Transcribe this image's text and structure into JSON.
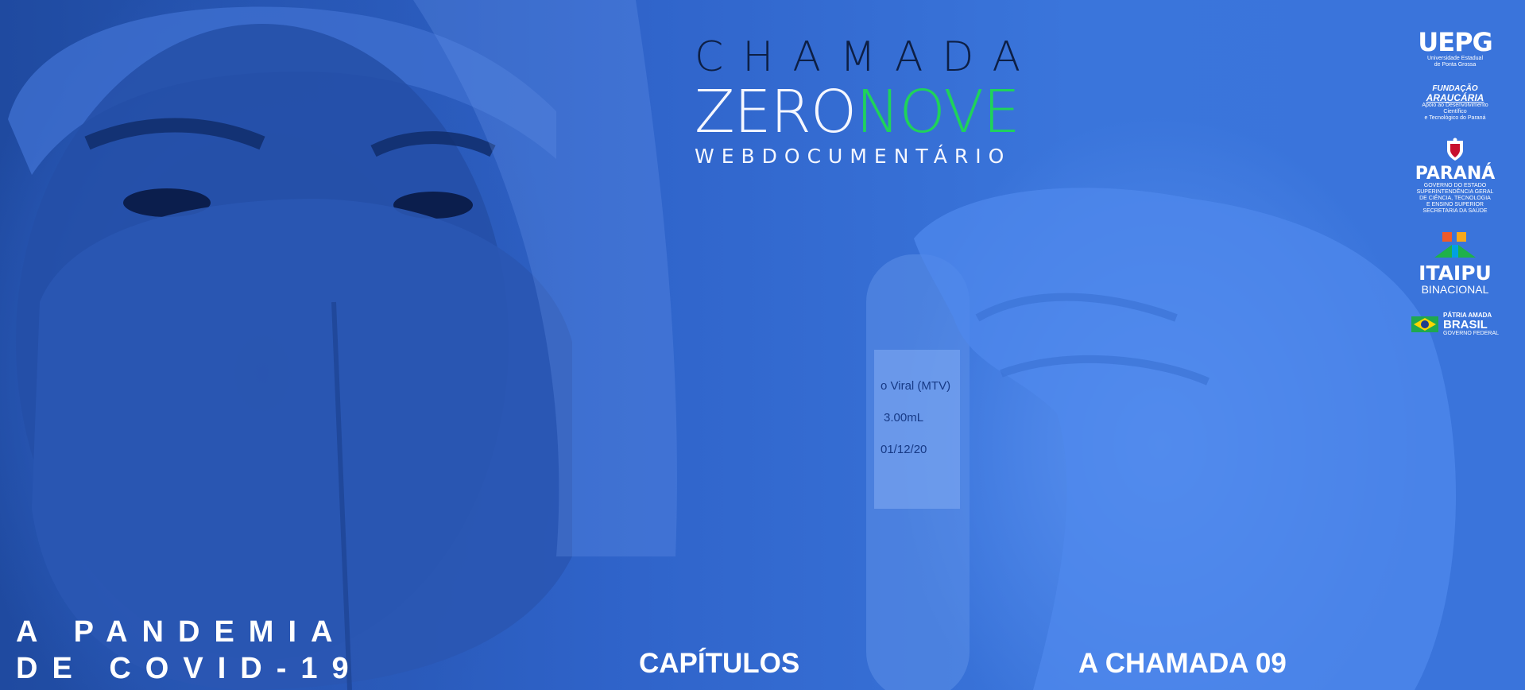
{
  "brand": {
    "title_top": "CHAMADA",
    "title_zero": "ZERO",
    "title_nove": "NOVE",
    "subtitle": "WEBDOCUMENTÁRIO",
    "colors": {
      "zero": "#f5f7ff",
      "nove": "#1fd35a",
      "top": "#0d1f45"
    }
  },
  "sponsors": {
    "uepg": {
      "mark": "UEPG",
      "line1": "Universidade Estadual",
      "line2": "de Ponta Grossa"
    },
    "araucaria": {
      "line1": "FUNDAÇÃO",
      "line2": "ARAUCÁRIA",
      "line3": "Apoio ao Desenvolvimento Científico",
      "line4": "e Tecnológico do Paraná"
    },
    "parana": {
      "name": "PARANÁ",
      "gov": "GOVERNO DO ESTADO",
      "line1": "SUPERINTENDÊNCIA GERAL",
      "line2": "DE CIÊNCIA, TECNOLOGIA",
      "line3": "E ENSINO SUPERIOR",
      "line4": "SECRETARIA DA SAÚDE"
    },
    "itaipu": {
      "name": "ITAIPU",
      "sub": "BINACIONAL"
    },
    "brasil": {
      "line1": "PÁTRIA AMADA",
      "line2": "BRASIL",
      "line3": "GOVERNO FEDERAL"
    }
  },
  "hero": {
    "tagline_line1": "A PANDEMIA",
    "tagline_line2": "DE COVID-19",
    "tube_label_1": "o Viral (MTV)",
    "tube_label_2": "3.00mL",
    "tube_label_3": "01/12/20"
  },
  "nav": {
    "capitulos": "CAPÍTULOS",
    "chamada": "A CHAMADA 09"
  }
}
